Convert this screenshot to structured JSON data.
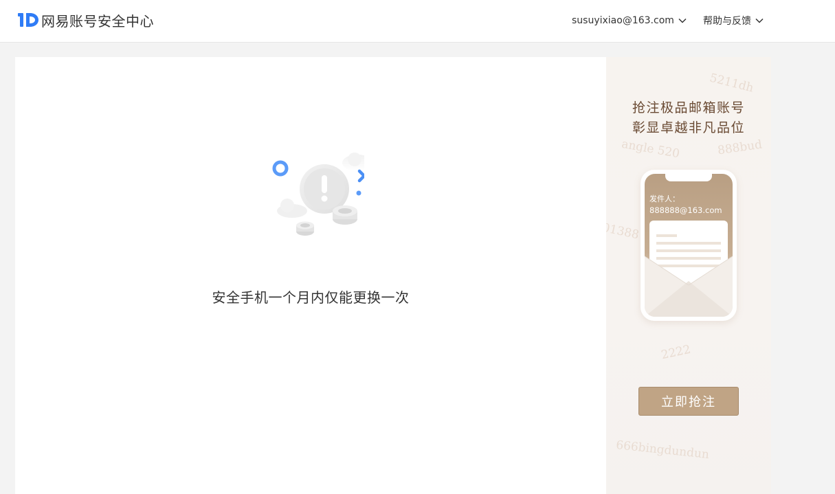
{
  "header": {
    "logo_text": "网易账号安全中心",
    "account_email": "susuyixiao@163.com",
    "help_label": "帮助与反馈"
  },
  "main": {
    "message": "安全手机一个月内仅能更换一次"
  },
  "promo": {
    "headline_line1": "抢注极品邮箱账号",
    "headline_line2": "彰显卓越非凡品位",
    "sender_label": "发件人：",
    "sender_email": "888888@163.com",
    "button_label": "立即抢注",
    "watermarks": [
      "5211dh",
      "angle 520",
      "888bud",
      "01388",
      "2222",
      "666bingdundun"
    ]
  },
  "colors": {
    "brand_blue": "#2f7cf6",
    "promo_brown": "#c0a485",
    "headline_brown": "#6a4a33"
  },
  "icons": {
    "logo": "netease-id-logo-icon",
    "dropdown": "chevron-down-icon",
    "illustration": "warning-illustration-icon"
  }
}
